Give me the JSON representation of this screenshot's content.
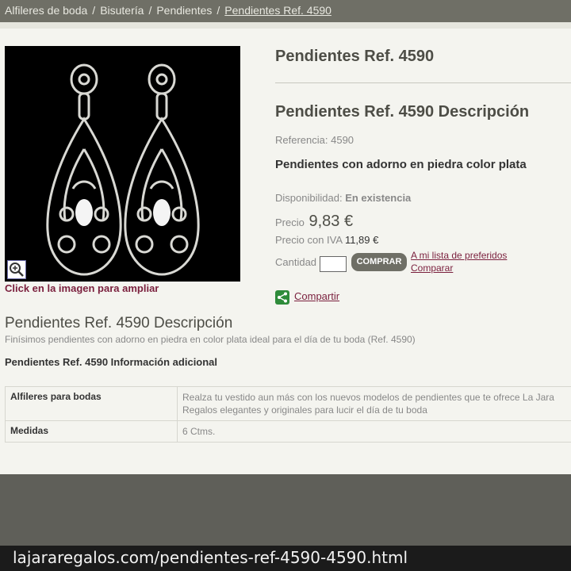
{
  "breadcrumb": {
    "items": [
      "Alfileres de boda",
      "Bisutería",
      "Pendientes"
    ],
    "current": "Pendientes Ref. 4590",
    "separator": "/"
  },
  "product": {
    "title": "Pendientes Ref. 4590",
    "description_title": "Pendientes Ref. 4590 Descripción",
    "reference_label": "Referencia:",
    "reference_value": "4590",
    "short_description": "Pendientes con adorno en piedra color plata",
    "availability_label": "Disponibilidad:",
    "availability_value": "En existencia",
    "price_label": "Precio",
    "price_value": "9,83 €",
    "price_iva_label": "Precio con IVA",
    "price_iva_value": "11,89 €",
    "quantity_label": "Cantidad",
    "quantity_value": "",
    "buy_label": "COMPRAR",
    "wishlist_label": "A mi lista de preferidos",
    "compare_label": "Comparar",
    "share_label": "Compartir",
    "image_caption": "Click en la imagen para ampliar"
  },
  "details": {
    "heading": "Pendientes Ref. 4590 Descripción",
    "text": "Finísimos pendientes con adorno en piedra en color plata ideal para el día de tu boda (Ref. 4590)",
    "additional_heading": "Pendientes Ref. 4590 Información adicional",
    "rows": [
      {
        "key": "Alfileres para bodas",
        "value": "Realza tu vestido aun más con los nuevos modelos de pendientes que te ofrece La Jara Regalos elegantes y originales para lucir el día de tu boda"
      },
      {
        "key": "Medidas",
        "value": "6 Ctms."
      }
    ]
  },
  "url": "lajararegalos.com/pendientes-ref-4590-4590.html",
  "icons": {
    "zoom": "magnifier-plus-icon",
    "share": "share-icon"
  },
  "colors": {
    "link": "#7a1f3d",
    "bar": "#6f6f66",
    "share": "#2e8b3a"
  }
}
